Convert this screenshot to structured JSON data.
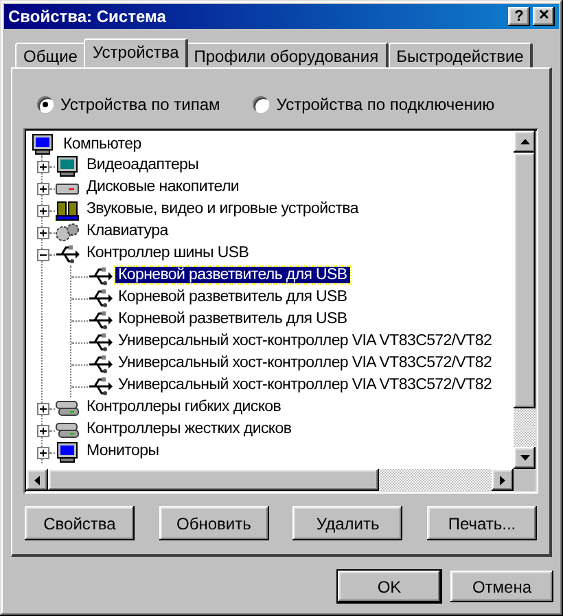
{
  "window": {
    "title": "Свойства: Система",
    "help_button": "?",
    "close_button": "✕"
  },
  "tabs": [
    {
      "label": "Общие",
      "selected": false
    },
    {
      "label": "Устройства",
      "selected": true
    },
    {
      "label": "Профили оборудования",
      "selected": false
    },
    {
      "label": "Быстродействие",
      "selected": false
    }
  ],
  "view_options": [
    {
      "label": "Устройства по типам",
      "selected": true
    },
    {
      "label": "Устройства по подключению",
      "selected": false
    }
  ],
  "tree": {
    "label": "Компьютер",
    "kind": "computer",
    "selected": false,
    "children": [
      {
        "label": "Видеоадаптеры",
        "kind": "display",
        "expanded": false,
        "selected": false
      },
      {
        "label": "Дисковые накопители",
        "kind": "disk",
        "expanded": false,
        "selected": false
      },
      {
        "label": "Звуковые, видео и игровые устройства",
        "kind": "sound",
        "expanded": false,
        "selected": false
      },
      {
        "label": "Клавиатура",
        "kind": "keyboard",
        "expanded": false,
        "selected": false
      },
      {
        "label": "Контроллер шины USB",
        "kind": "usb",
        "expanded": true,
        "selected": false,
        "children": [
          {
            "label": "Корневой разветвитель для USB",
            "kind": "usb",
            "selected": true
          },
          {
            "label": "Корневой разветвитель для USB",
            "kind": "usb",
            "selected": false
          },
          {
            "label": "Корневой разветвитель для USB",
            "kind": "usb",
            "selected": false
          },
          {
            "label": "Универсальный хост-контроллер VIA VT83C572/VT82",
            "kind": "usb",
            "selected": false
          },
          {
            "label": "Универсальный хост-контроллер VIA VT83C572/VT82",
            "kind": "usb",
            "selected": false
          },
          {
            "label": "Универсальный хост-контроллер VIA VT83C572/VT82",
            "kind": "usb",
            "selected": false
          }
        ]
      },
      {
        "label": "Контроллеры гибких дисков",
        "kind": "controller",
        "expanded": false,
        "selected": false
      },
      {
        "label": "Контроллеры жестких дисков",
        "kind": "controller",
        "expanded": false,
        "selected": false
      },
      {
        "label": "Мониторы",
        "kind": "monitor",
        "expanded": false,
        "selected": false
      }
    ]
  },
  "actions": [
    "Свойства",
    "Обновить",
    "Удалить",
    "Печать..."
  ],
  "dialog_buttons": [
    "OK",
    "Отмена"
  ]
}
